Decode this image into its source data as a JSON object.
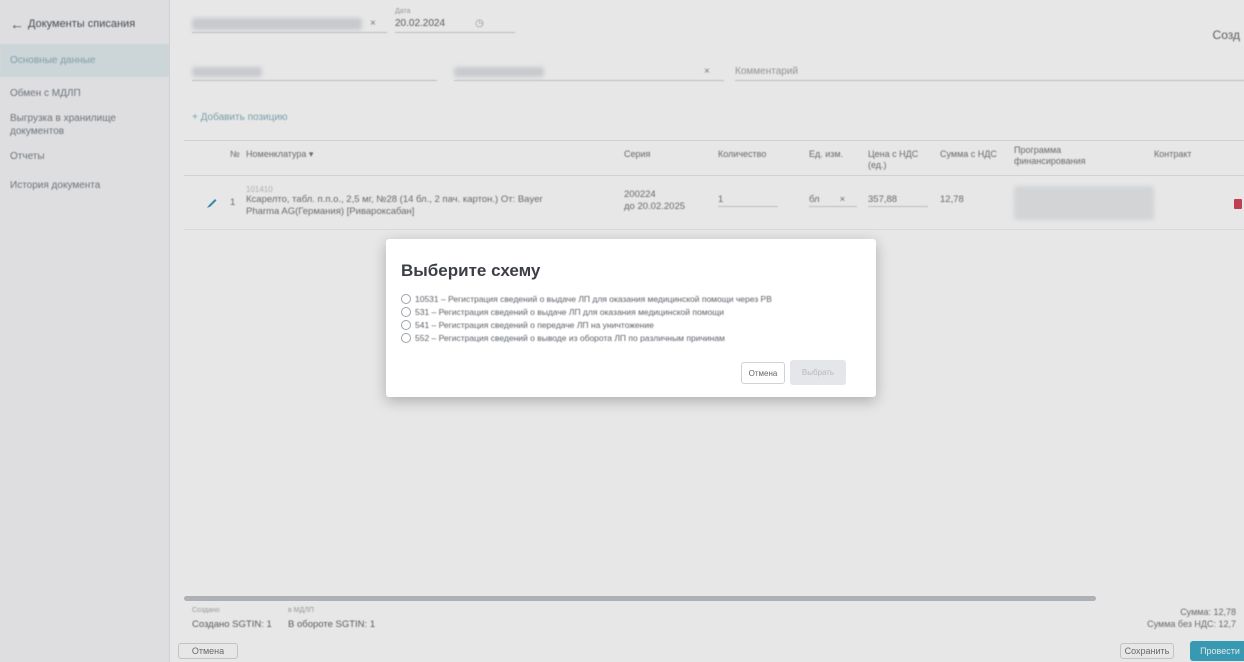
{
  "sidebar": {
    "back_label": "Документы списания",
    "items": [
      {
        "label": "Основные данные",
        "active": true
      },
      {
        "label": "Обмен с МДЛП",
        "active": false
      },
      {
        "label": "Выгрузка в хранилище документов",
        "active": false
      },
      {
        "label": "Отчеты",
        "active": false
      },
      {
        "label": "История документа",
        "active": false
      }
    ]
  },
  "header": {
    "date_label": "Дата",
    "date_value": "20.02.2024",
    "right_label": "Созд",
    "comment_placeholder": "Комментарий"
  },
  "table": {
    "add_position": "+ Добавить позицию",
    "columns": {
      "num": "№",
      "nomenclature": "Номенклатура",
      "series": "Серия",
      "quantity": "Количество",
      "unit": "Ед. изм.",
      "price_vat": "Цена с НДС (ед.)",
      "sum_vat": "Сумма с НДС",
      "program": "Программа финансирования",
      "contract": "Контракт"
    },
    "rows": [
      {
        "num": "1",
        "code": "101410",
        "name": "Ксарелто, табл. п.п.о., 2,5 мг, №28 (14 бл., 2 пач. картон.) От: Bayer Pharma AG(Германия) [Ривароксабан]",
        "series": "200224",
        "expiry": "до 20.02.2025",
        "quantity": "1",
        "unit": "бл",
        "price": "357,88",
        "sum": "12,78"
      }
    ]
  },
  "footer": {
    "created_label": "Создано",
    "created_value": "Создано SGTIN: 1",
    "turnover_label": "в МДЛП",
    "turnover_value": "В обороте SGTIN: 1",
    "sum": "Сумма: 12,78",
    "sum_no_vat": "Сумма без НДС: 12,7",
    "cancel": "Отмена",
    "save": "Сохранить",
    "post": "Провести"
  },
  "modal": {
    "title": "Выберите схему",
    "options": [
      "10531 – Регистрация сведений о выдаче ЛП для оказания медицинской помощи через РВ",
      "531 – Регистрация сведений о выдаче ЛП для оказания медицинской помощи",
      "541 – Регистрация сведений о передаче ЛП на уничтожение",
      "552 – Регистрация сведений о выводе из оборота ЛП по различным причинам"
    ],
    "cancel": "Отмена",
    "select": "Выбрать"
  }
}
